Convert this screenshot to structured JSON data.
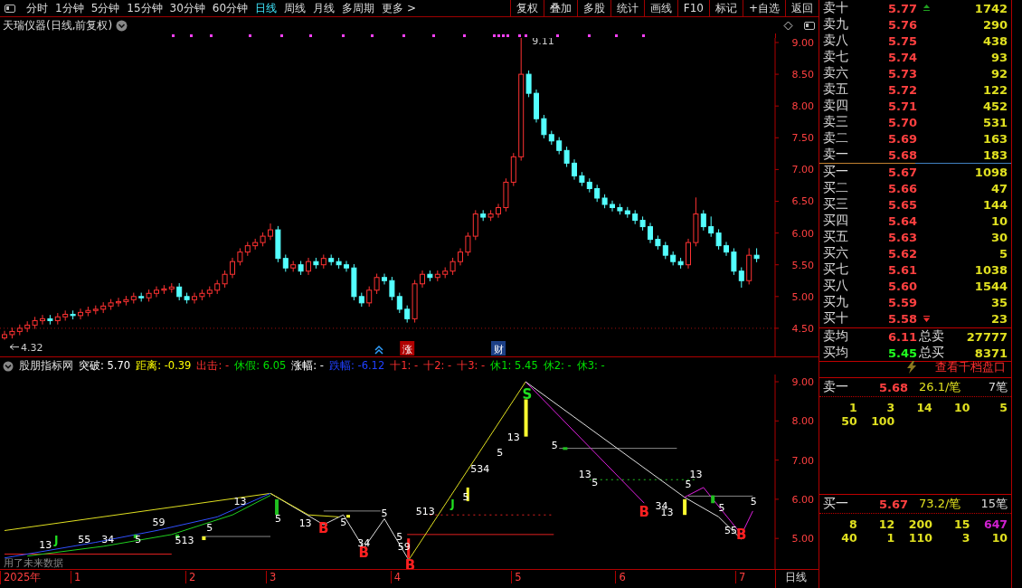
{
  "toolbar": {
    "periods": [
      {
        "label": "分时",
        "selected": false
      },
      {
        "label": "1分钟",
        "selected": false
      },
      {
        "label": "5分钟",
        "selected": false
      },
      {
        "label": "15分钟",
        "selected": false
      },
      {
        "label": "30分钟",
        "selected": false
      },
      {
        "label": "60分钟",
        "selected": false
      },
      {
        "label": "日线",
        "selected": true
      },
      {
        "label": "周线",
        "selected": false
      },
      {
        "label": "月线",
        "selected": false
      },
      {
        "label": "多周期",
        "selected": false
      },
      {
        "label": "更多 >",
        "selected": false
      }
    ],
    "actions": [
      "复权",
      "叠加",
      "多股",
      "统计",
      "画线",
      "F10",
      "标记",
      "+自选",
      "返回"
    ]
  },
  "chart": {
    "title": "天瑞仪器(日线,前复权)",
    "high_label": "9.11",
    "low_label": "4.32",
    "badges": [
      {
        "text": "涨",
        "color": "#b00000"
      },
      {
        "text": "财",
        "color": "#1c3f86"
      }
    ],
    "chart_data": {
      "type": "candlestick",
      "ylim": [
        4.057,
        9.071
      ],
      "yticks": [
        {
          "value": 9,
          "label": "9.00"
        },
        {
          "value": 8.5,
          "label": "8.50"
        },
        {
          "value": 8,
          "label": "8.00"
        },
        {
          "value": 7.5,
          "label": "7.50"
        },
        {
          "value": 7,
          "label": "7.00"
        },
        {
          "value": 6.5,
          "label": "6.50"
        },
        {
          "value": 6,
          "label": "6.00"
        },
        {
          "value": 5.5,
          "label": "5.50"
        },
        {
          "value": 5,
          "label": "5.00"
        },
        {
          "value": 4.5,
          "label": "4.50"
        }
      ],
      "ohlc": [
        [
          4.35,
          4.46,
          4.32,
          4.4
        ],
        [
          4.4,
          4.51,
          4.34,
          4.45
        ],
        [
          4.45,
          4.56,
          4.39,
          4.5
        ],
        [
          4.5,
          4.61,
          4.44,
          4.55
        ],
        [
          4.55,
          4.68,
          4.49,
          4.62
        ],
        [
          4.62,
          4.71,
          4.56,
          4.65
        ],
        [
          4.65,
          4.71,
          4.56,
          4.62
        ],
        [
          4.62,
          4.74,
          4.56,
          4.68
        ],
        [
          4.68,
          4.78,
          4.62,
          4.72
        ],
        [
          4.72,
          4.78,
          4.64,
          4.7
        ],
        [
          4.7,
          4.81,
          4.64,
          4.75
        ],
        [
          4.75,
          4.84,
          4.69,
          4.78
        ],
        [
          4.78,
          4.86,
          4.72,
          4.8
        ],
        [
          4.8,
          4.91,
          4.74,
          4.85
        ],
        [
          4.85,
          4.96,
          4.79,
          4.9
        ],
        [
          4.9,
          4.98,
          4.84,
          4.92
        ],
        [
          4.92,
          5.01,
          4.86,
          4.95
        ],
        [
          4.95,
          5.06,
          4.89,
          5.0
        ],
        [
          5.0,
          5.06,
          4.92,
          4.98
        ],
        [
          4.98,
          5.11,
          4.92,
          5.05
        ],
        [
          5.05,
          5.16,
          4.99,
          5.1
        ],
        [
          5.1,
          5.18,
          5.04,
          5.12
        ],
        [
          5.12,
          5.21,
          5.06,
          5.15
        ],
        [
          5.15,
          5.21,
          4.94,
          5.0
        ],
        [
          5.0,
          5.06,
          4.89,
          4.95
        ],
        [
          4.95,
          5.06,
          4.89,
          5.0
        ],
        [
          5.0,
          5.11,
          4.94,
          5.05
        ],
        [
          5.05,
          5.16,
          4.99,
          5.1
        ],
        [
          5.1,
          5.26,
          5.04,
          5.2
        ],
        [
          5.2,
          5.41,
          5.14,
          5.35
        ],
        [
          5.35,
          5.61,
          5.29,
          5.55
        ],
        [
          5.55,
          5.76,
          5.49,
          5.7
        ],
        [
          5.7,
          5.86,
          5.64,
          5.8
        ],
        [
          5.8,
          5.91,
          5.74,
          5.85
        ],
        [
          5.85,
          6.01,
          5.79,
          5.95
        ],
        [
          5.95,
          6.15,
          5.89,
          6.05
        ],
        [
          6.05,
          6.11,
          5.54,
          5.6
        ],
        [
          5.6,
          5.66,
          5.39,
          5.45
        ],
        [
          5.45,
          5.56,
          5.39,
          5.5
        ],
        [
          5.5,
          5.56,
          5.34,
          5.4
        ],
        [
          5.4,
          5.61,
          5.34,
          5.55
        ],
        [
          5.55,
          5.61,
          5.44,
          5.5
        ],
        [
          5.5,
          5.66,
          5.44,
          5.6
        ],
        [
          5.6,
          5.66,
          5.49,
          5.55
        ],
        [
          5.55,
          5.61,
          5.44,
          5.5
        ],
        [
          5.5,
          5.56,
          5.39,
          5.45
        ],
        [
          5.45,
          5.51,
          4.94,
          5.0
        ],
        [
          5.0,
          5.06,
          4.84,
          4.9
        ],
        [
          4.9,
          5.16,
          4.84,
          5.1
        ],
        [
          5.1,
          5.36,
          5.04,
          5.3
        ],
        [
          5.3,
          5.36,
          5.19,
          5.25
        ],
        [
          5.25,
          5.31,
          4.94,
          5.0
        ],
        [
          5.0,
          5.06,
          4.74,
          4.8
        ],
        [
          4.8,
          4.86,
          4.59,
          4.65
        ],
        [
          4.65,
          5.26,
          4.59,
          5.2
        ],
        [
          5.2,
          5.41,
          5.14,
          5.35
        ],
        [
          5.35,
          5.41,
          5.24,
          5.3
        ],
        [
          5.3,
          5.41,
          5.24,
          5.35
        ],
        [
          5.35,
          5.46,
          5.29,
          5.4
        ],
        [
          5.4,
          5.61,
          5.34,
          5.55
        ],
        [
          5.55,
          5.76,
          5.49,
          5.7
        ],
        [
          5.7,
          6.01,
          5.64,
          5.95
        ],
        [
          5.95,
          6.36,
          5.89,
          6.3
        ],
        [
          6.3,
          6.36,
          6.19,
          6.25
        ],
        [
          6.25,
          6.36,
          6.19,
          6.3
        ],
        [
          6.3,
          6.46,
          6.24,
          6.4
        ],
        [
          6.4,
          6.86,
          6.34,
          6.8
        ],
        [
          6.8,
          7.26,
          6.74,
          7.2
        ],
        [
          7.2,
          9.11,
          7.14,
          8.5
        ],
        [
          8.5,
          8.56,
          8.14,
          8.2
        ],
        [
          8.2,
          8.26,
          7.74,
          7.8
        ],
        [
          7.8,
          7.86,
          7.49,
          7.55
        ],
        [
          7.55,
          7.61,
          7.39,
          7.45
        ],
        [
          7.45,
          7.51,
          7.24,
          7.3
        ],
        [
          7.3,
          7.36,
          7.04,
          7.1
        ],
        [
          7.1,
          7.16,
          6.84,
          6.9
        ],
        [
          6.9,
          6.96,
          6.74,
          6.8
        ],
        [
          6.8,
          6.86,
          6.64,
          6.7
        ],
        [
          6.7,
          6.76,
          6.49,
          6.55
        ],
        [
          6.55,
          6.61,
          6.39,
          6.45
        ],
        [
          6.45,
          6.51,
          6.34,
          6.4
        ],
        [
          6.4,
          6.46,
          6.29,
          6.35
        ],
        [
          6.35,
          6.41,
          6.24,
          6.3
        ],
        [
          6.3,
          6.36,
          6.14,
          6.2
        ],
        [
          6.2,
          6.26,
          6.04,
          6.1
        ],
        [
          6.1,
          6.16,
          5.84,
          5.9
        ],
        [
          5.9,
          5.96,
          5.74,
          5.8
        ],
        [
          5.8,
          5.86,
          5.59,
          5.65
        ],
        [
          5.65,
          5.71,
          5.49,
          5.55
        ],
        [
          5.55,
          5.61,
          5.44,
          5.5
        ],
        [
          5.5,
          5.91,
          5.44,
          5.85
        ],
        [
          5.85,
          6.56,
          5.79,
          6.3
        ],
        [
          6.3,
          6.36,
          6.04,
          6.1
        ],
        [
          6.1,
          6.26,
          5.94,
          6.0
        ],
        [
          6.0,
          6.06,
          5.74,
          5.8
        ],
        [
          5.8,
          5.86,
          5.64,
          5.7
        ],
        [
          5.7,
          5.76,
          5.34,
          5.4
        ],
        [
          5.4,
          5.46,
          5.14,
          5.25
        ],
        [
          5.25,
          5.76,
          5.19,
          5.65
        ],
        [
          5.65,
          5.76,
          5.54,
          5.6
        ]
      ]
    }
  },
  "indicator": {
    "name": "股朋指标网",
    "items": [
      {
        "text": "突破: 5.70",
        "color": "#ffffff"
      },
      {
        "text": "距离: -0.39",
        "color": "#ffff00"
      },
      {
        "text": "出击: -",
        "color": "#ff3030"
      },
      {
        "text": "休假: 6.05",
        "color": "#00e000"
      },
      {
        "text": "涨幅: -",
        "color": "#ffffff"
      },
      {
        "text": "跌幅: -6.12",
        "color": "#2040ff"
      },
      {
        "text": "十1: -",
        "color": "#ff3030"
      },
      {
        "text": "十2: -",
        "color": "#ff3030"
      },
      {
        "text": "十3: -",
        "color": "#ff3030"
      },
      {
        "text": "休1: 5.45",
        "color": "#00e000"
      },
      {
        "text": "休2: -",
        "color": "#00e000"
      },
      {
        "text": "休3: -",
        "color": "#00e000"
      }
    ]
  },
  "lower_panel": {
    "yticks": [
      "9.00",
      "8.00",
      "7.00",
      "6.00",
      "5.00"
    ],
    "note": "用了未来数据",
    "labels": [
      {
        "text": "13",
        "kind": "count"
      },
      {
        "text": "J",
        "kind": "j"
      },
      {
        "text": "55",
        "kind": "count"
      },
      {
        "text": "34",
        "kind": "count"
      },
      {
        "text": "5",
        "kind": "count"
      },
      {
        "text": "59",
        "kind": "count"
      },
      {
        "text": "513",
        "kind": "count"
      },
      {
        "text": "5",
        "kind": "count"
      },
      {
        "text": "13",
        "kind": "count"
      },
      {
        "text": "5",
        "kind": "count"
      },
      {
        "text": "13",
        "kind": "count"
      },
      {
        "text": "B",
        "kind": "buy"
      },
      {
        "text": "5",
        "kind": "count"
      },
      {
        "text": "34",
        "kind": "count"
      },
      {
        "text": "B",
        "kind": "buy"
      },
      {
        "text": "5",
        "kind": "count"
      },
      {
        "text": "5",
        "kind": "count"
      },
      {
        "text": "59",
        "kind": "count"
      },
      {
        "text": "B",
        "kind": "buy"
      },
      {
        "text": "513",
        "kind": "count"
      },
      {
        "text": "J",
        "kind": "j"
      },
      {
        "text": "5",
        "kind": "count"
      },
      {
        "text": "534",
        "kind": "count"
      },
      {
        "text": "5",
        "kind": "count"
      },
      {
        "text": "13",
        "kind": "count"
      },
      {
        "text": "S",
        "kind": "sell"
      },
      {
        "text": "5",
        "kind": "count"
      },
      {
        "text": "13",
        "kind": "count"
      },
      {
        "text": "5",
        "kind": "count"
      },
      {
        "text": "B",
        "kind": "buy"
      },
      {
        "text": "34",
        "kind": "count"
      },
      {
        "text": "13",
        "kind": "count"
      },
      {
        "text": "5",
        "kind": "count"
      },
      {
        "text": "13",
        "kind": "count"
      },
      {
        "text": "5",
        "kind": "count"
      },
      {
        "text": "55",
        "kind": "count"
      },
      {
        "text": "B",
        "kind": "buy"
      },
      {
        "text": "5",
        "kind": "count"
      }
    ]
  },
  "x_axis": {
    "labels": [
      "2025年",
      "1",
      "2",
      "3",
      "4",
      "5",
      "6",
      "7"
    ],
    "period": "日线"
  },
  "order_book": {
    "asks": [
      {
        "label": "卖十",
        "price": "5.77",
        "volume": "1742",
        "arrow": true
      },
      {
        "label": "卖九",
        "price": "5.76",
        "volume": "290",
        "arrow": false
      },
      {
        "label": "卖八",
        "price": "5.75",
        "volume": "438",
        "arrow": false
      },
      {
        "label": "卖七",
        "price": "5.74",
        "volume": "93",
        "arrow": false
      },
      {
        "label": "卖六",
        "price": "5.73",
        "volume": "92",
        "arrow": false
      },
      {
        "label": "卖五",
        "price": "5.72",
        "volume": "122",
        "arrow": false
      },
      {
        "label": "卖四",
        "price": "5.71",
        "volume": "452",
        "arrow": false
      },
      {
        "label": "卖三",
        "price": "5.70",
        "volume": "531",
        "arrow": false
      },
      {
        "label": "卖二",
        "price": "5.69",
        "volume": "163",
        "arrow": false
      },
      {
        "label": "卖一",
        "price": "5.68",
        "volume": "183",
        "arrow": false
      }
    ],
    "bids": [
      {
        "label": "买一",
        "price": "5.67",
        "volume": "1098",
        "arrow": false
      },
      {
        "label": "买二",
        "price": "5.66",
        "volume": "47",
        "arrow": false
      },
      {
        "label": "买三",
        "price": "5.65",
        "volume": "144",
        "arrow": false
      },
      {
        "label": "买四",
        "price": "5.64",
        "volume": "10",
        "arrow": false
      },
      {
        "label": "买五",
        "price": "5.63",
        "volume": "30",
        "arrow": false
      },
      {
        "label": "买六",
        "price": "5.62",
        "volume": "5",
        "arrow": false
      },
      {
        "label": "买七",
        "price": "5.61",
        "volume": "1038",
        "arrow": false
      },
      {
        "label": "买八",
        "price": "5.60",
        "volume": "1544",
        "arrow": false
      },
      {
        "label": "买九",
        "price": "5.59",
        "volume": "35",
        "arrow": false
      },
      {
        "label": "买十",
        "price": "5.58",
        "volume": "23",
        "arrow": true
      }
    ],
    "summary": [
      {
        "label": "卖均",
        "price": "6.11",
        "total_label": "总卖",
        "total": "27777",
        "kind": "sell"
      },
      {
        "label": "买均",
        "price": "5.45",
        "total_label": "总买",
        "total": "8371",
        "kind": "buy"
      }
    ]
  },
  "depth": {
    "link": "查看千档盘口",
    "sides": [
      {
        "label": "卖一",
        "price": "5.68",
        "avg": "26.1/笔",
        "count": "7笔",
        "queue": [
          [
            {
              "text": "1",
              "large": false
            },
            {
              "text": "3",
              "large": false
            },
            {
              "text": "14",
              "large": false
            },
            {
              "text": "10",
              "large": false
            },
            {
              "text": "5",
              "large": false
            }
          ],
          [
            {
              "text": "50",
              "large": false
            },
            {
              "text": "100",
              "large": false
            }
          ]
        ]
      },
      {
        "label": "买一",
        "price": "5.67",
        "avg": "73.2/笔",
        "count": "15笔",
        "queue": [
          [
            {
              "text": "8",
              "large": false
            },
            {
              "text": "12",
              "large": false
            },
            {
              "text": "200",
              "large": false
            },
            {
              "text": "15",
              "large": false
            },
            {
              "text": "647",
              "large": true
            }
          ],
          [
            {
              "text": "40",
              "large": false
            },
            {
              "text": "1",
              "large": false
            },
            {
              "text": "110",
              "large": false
            },
            {
              "text": "3",
              "large": false
            },
            {
              "text": "10",
              "large": false
            }
          ]
        ]
      }
    ]
  }
}
